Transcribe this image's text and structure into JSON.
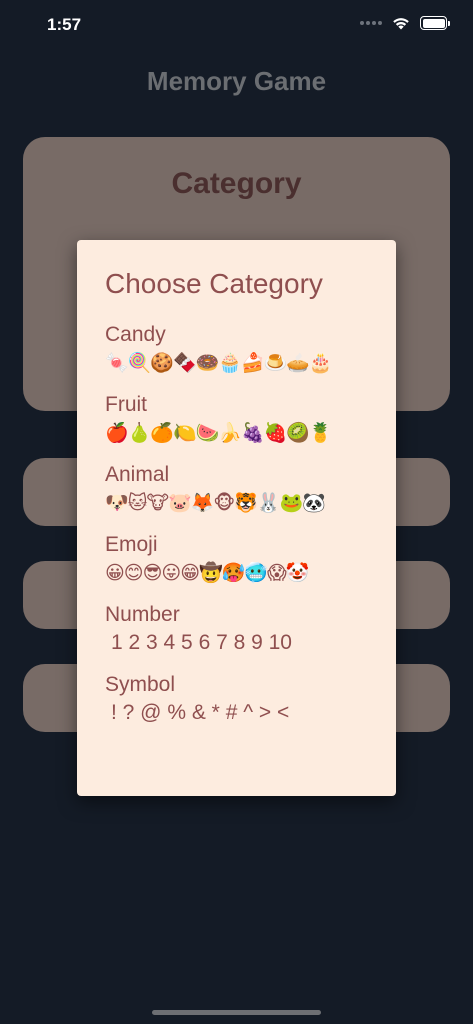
{
  "status_bar": {
    "time": "1:57"
  },
  "app": {
    "title": "Memory Game"
  },
  "background": {
    "category_card_title": "Category"
  },
  "dialog": {
    "title": "Choose Category",
    "options": [
      {
        "label": "Candy",
        "preview": "🍬🍭🍪🍫🍩🧁🍰🍮🥧🎂"
      },
      {
        "label": "Fruit",
        "preview": "🍎🍐🍊🍋🍉🍌🍇🍓🥝🍍"
      },
      {
        "label": "Animal",
        "preview": "🐶🐱🐮🐷🦊🐵🐯🐰🐸🐼"
      },
      {
        "label": "Emoji",
        "preview": "😀😊😎😛😁🤠🥵🥶😱🤡"
      },
      {
        "label": "Number",
        "preview": "1 2 3 4 5 6 7 8 9 10"
      },
      {
        "label": "Symbol",
        "preview": "! ? @ % & * # ^ > <"
      }
    ]
  }
}
